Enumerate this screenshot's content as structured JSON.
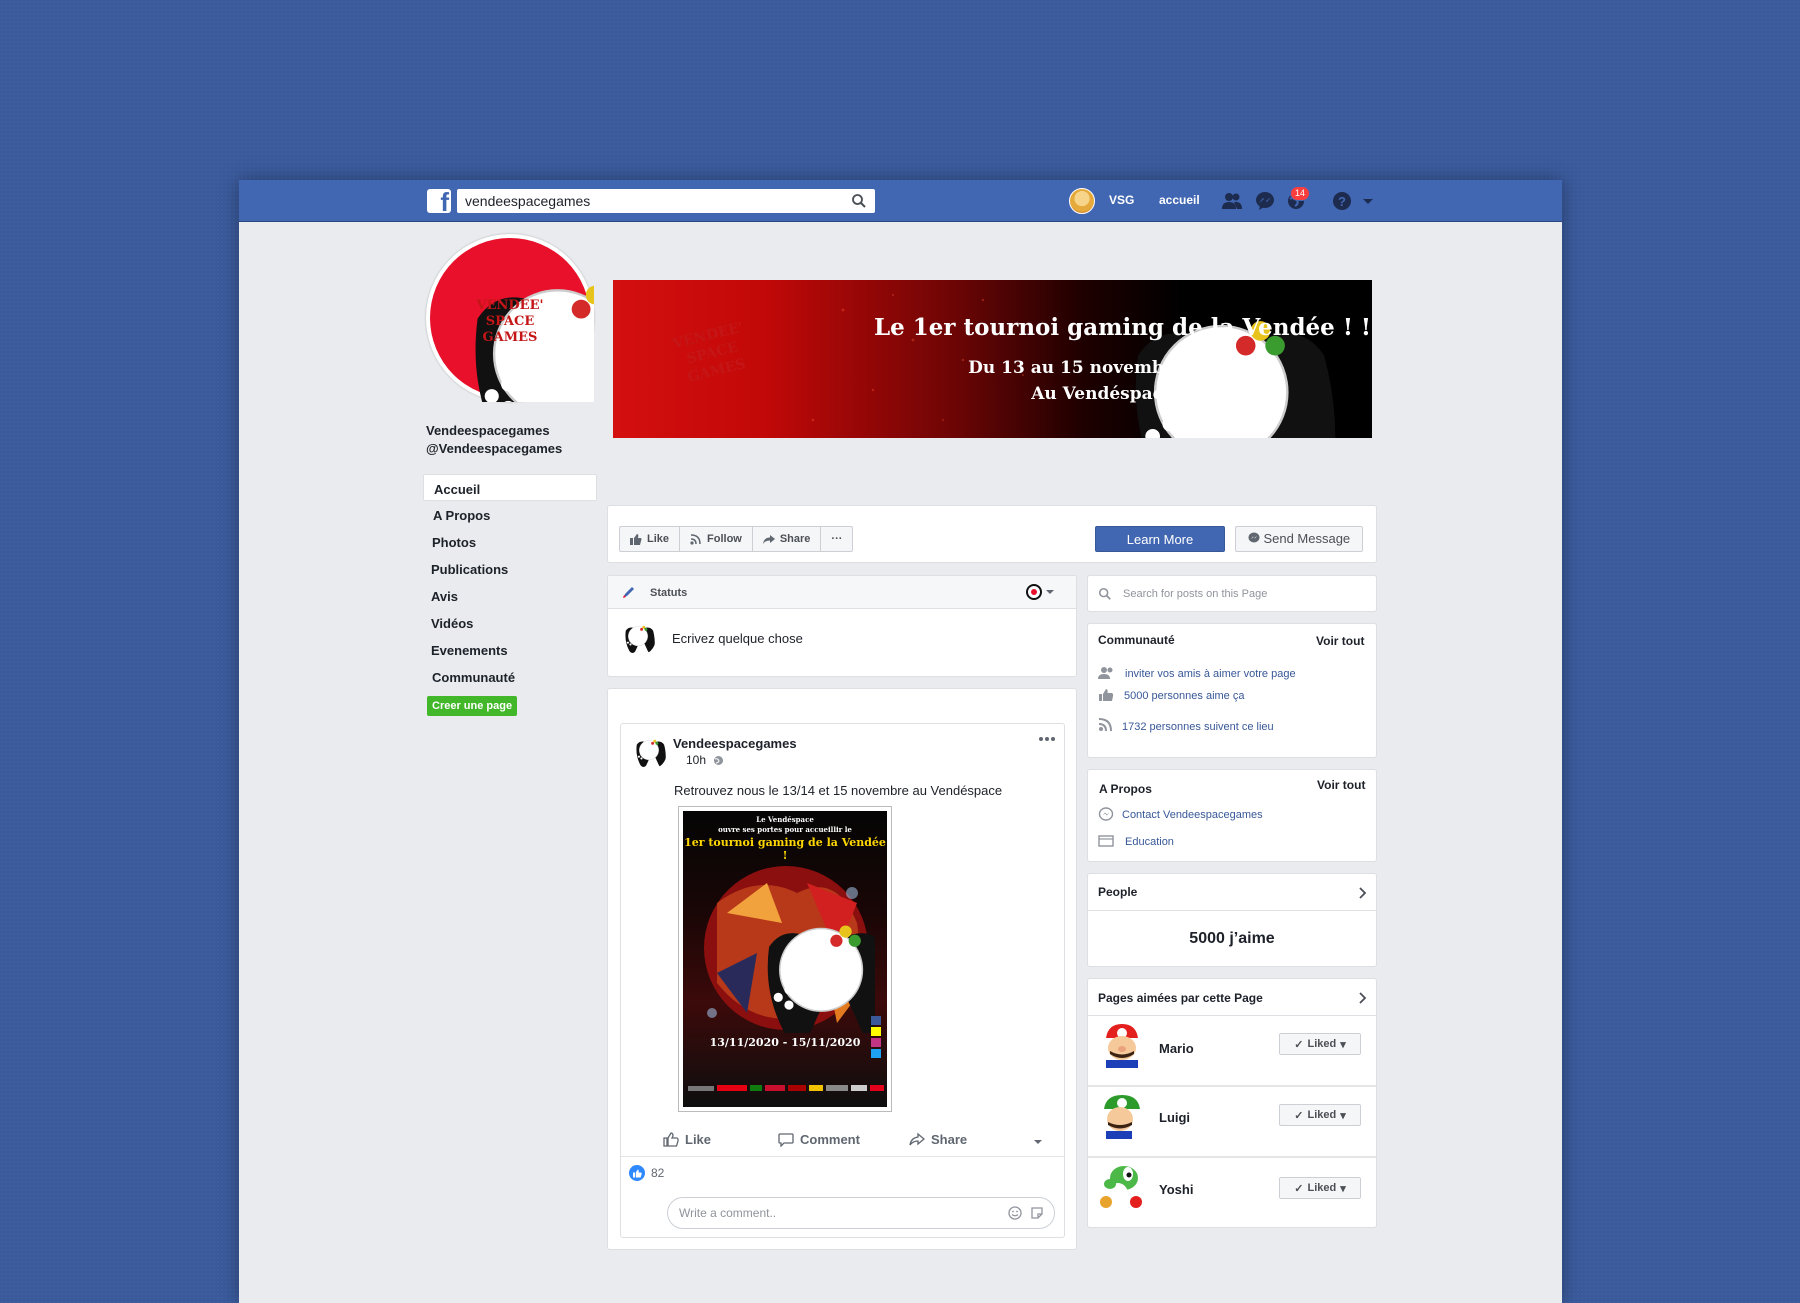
{
  "topbar": {
    "logo": "f",
    "search_value": "vendeespacegames",
    "user_short": "VSG",
    "home_label": "accueil",
    "notifications_count": "14"
  },
  "profile": {
    "name": "Vendeespacegames",
    "handle": "@Vendeespacegames",
    "logo_text": [
      "VENDEE'",
      "SPACE",
      "GAMES"
    ]
  },
  "left_nav": {
    "items": [
      "Accueil",
      "A Propos",
      "Photos",
      "Publications",
      "Avis",
      "Vidéos",
      "Evenements",
      "Communauté"
    ],
    "create_page": "Creer une page"
  },
  "cover": {
    "headline": "Le 1er tournoi gaming de la Vendée ! !",
    "dates": "Du 13 au 15 novembre 2020",
    "venue": "Au Vendéspace"
  },
  "actions": {
    "like": "Like",
    "follow": "Follow",
    "share": "Share",
    "more": "···",
    "learn_more": "Learn More",
    "send_message": "Send Message"
  },
  "composer": {
    "tab_label": "Statuts",
    "placeholder": "Ecrivez quelque chose"
  },
  "post": {
    "author": "Vendeespacegames",
    "time": "10h",
    "text": "Retrouvez nous le 13/14 et 15 novembre au Vendéspace",
    "poster": {
      "line1": "Le Vendéspace",
      "line2": "ouvre ses portes pour accueillir le",
      "headline": "1er tournoi gaming de la Vendée !",
      "dates": "13/11/2020 - 15/11/2020"
    },
    "like_label": "Like",
    "comment_label": "Comment",
    "share_label": "Share",
    "reaction_count": "82",
    "comment_placeholder": "Write a comment.."
  },
  "sidebar": {
    "search_placeholder": "Search for posts on this Page",
    "community": {
      "title": "Communauté",
      "see_all": "Voir tout",
      "invite": "inviter vos amis à aimer votre page",
      "likes": "5000 personnes aime ça",
      "follows": "1732 personnes suivent ce lieu"
    },
    "about": {
      "title": "A Propos",
      "see_all": "Voir tout",
      "contact": "Contact Vendeespacegames",
      "category": "Education"
    },
    "people": {
      "title": "People",
      "likes_total": "5000 j’aime"
    },
    "liked_pages": {
      "title": "Pages aimées par cette Page",
      "items": [
        {
          "name": "Mario",
          "button": "Liked"
        },
        {
          "name": "Luigi",
          "button": "Liked"
        },
        {
          "name": "Yoshi",
          "button": "Liked"
        }
      ]
    }
  },
  "colors": {
    "facebook_blue": "#4267b2",
    "background_blue": "#3a5a9c",
    "create_green": "#42b72a",
    "brand_red": "#d40f0f"
  }
}
